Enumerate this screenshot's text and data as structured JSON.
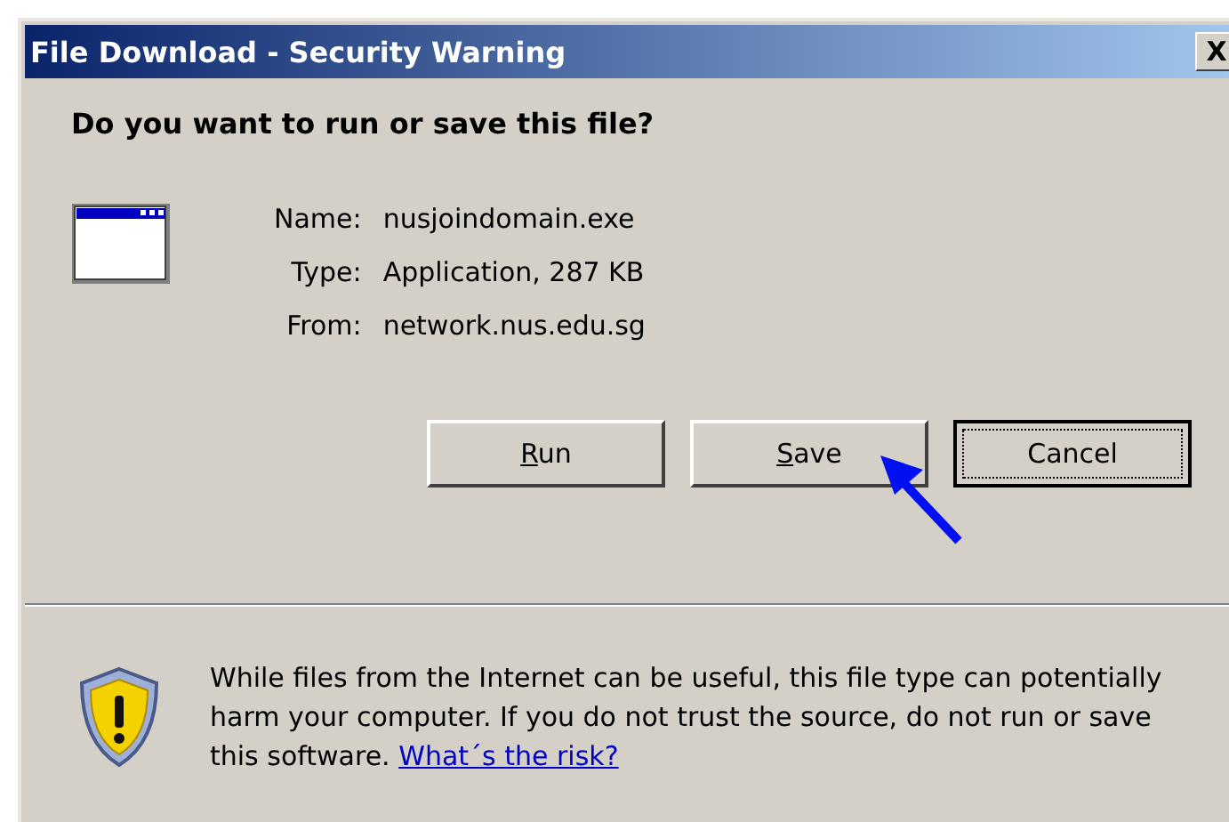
{
  "window": {
    "title": "File Download - Security Warning",
    "close_label": "X"
  },
  "question": "Do you want to run or save this file?",
  "details": [
    {
      "label": "Name:",
      "value": "nusjoindomain.exe"
    },
    {
      "label": "Type:",
      "value": "Application, 287 KB"
    },
    {
      "label": "From:",
      "value": "network.nus.edu.sg"
    }
  ],
  "buttons": [
    {
      "label": "Run",
      "focused": false
    },
    {
      "label": "Save",
      "focused": false
    },
    {
      "label": "Cancel",
      "focused": true
    }
  ],
  "warning": {
    "text": "While files from the Internet can be useful, this file type can potentially harm your computer. If you do not trust the source, do not run or save this software.",
    "link": "What´s the risk?"
  }
}
